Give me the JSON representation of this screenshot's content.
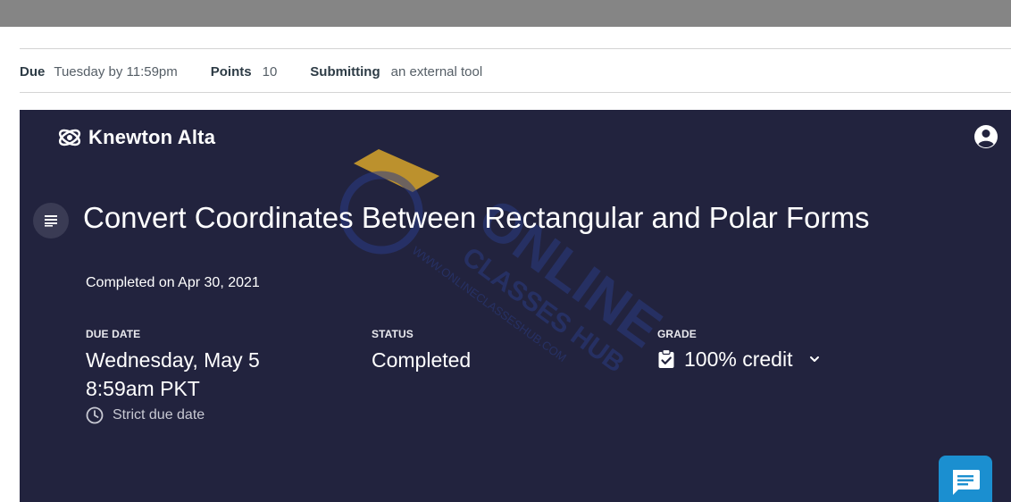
{
  "assignment_meta": {
    "due_label": "Due",
    "due_value": "Tuesday by 11:59pm",
    "points_label": "Points",
    "points_value": "10",
    "submitting_label": "Submitting",
    "submitting_value": "an external tool"
  },
  "tool": {
    "brand": "Knewton Alta",
    "title": "Convert Coordinates Between Rectangular and Polar Forms",
    "completed_on": "Completed on Apr 30, 2021",
    "due_date": {
      "label": "DUE DATE",
      "line1": "Wednesday, May 5",
      "line2": "8:59am PKT",
      "note": "Strict due date"
    },
    "status": {
      "label": "STATUS",
      "value": "Completed"
    },
    "grade": {
      "label": "GRADE",
      "value": "100% credit"
    },
    "watermark": {
      "line1": "ONLINE",
      "line2": "CLASSES HUB",
      "url": "WWW.ONLINECLASSESHUB.COM"
    }
  },
  "colors": {
    "tool_bg": "#22233e",
    "chat_button": "#1b8fd0",
    "top_bar": "#858585"
  },
  "icons": [
    "brand-logo-icon",
    "user-account-icon",
    "list-icon",
    "clock-icon",
    "clipboard-check-icon",
    "chevron-down-icon",
    "chat-icon"
  ]
}
